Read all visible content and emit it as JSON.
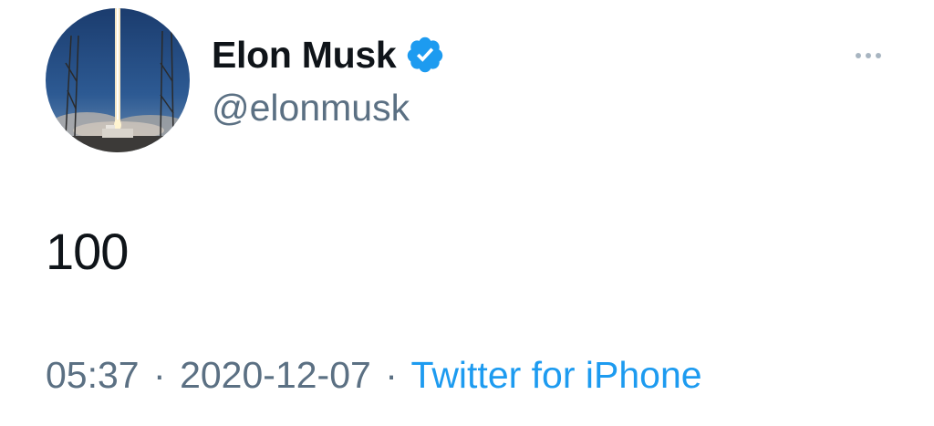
{
  "author": {
    "display_name": "Elon Musk",
    "handle": "@elonmusk",
    "verified": true,
    "avatar_icon": "rocket-launch-avatar",
    "verified_icon": "verified-badge-icon"
  },
  "tweet": {
    "text": "100",
    "time": "05:37",
    "date": "2020-12-07",
    "separator": "·",
    "source": "Twitter for iPhone"
  },
  "menu": {
    "icon": "more-options-icon"
  },
  "colors": {
    "text_primary": "#0f1419",
    "text_secondary": "#5b7083",
    "link": "#1d9bf0",
    "verified": "#1d9bf0"
  }
}
